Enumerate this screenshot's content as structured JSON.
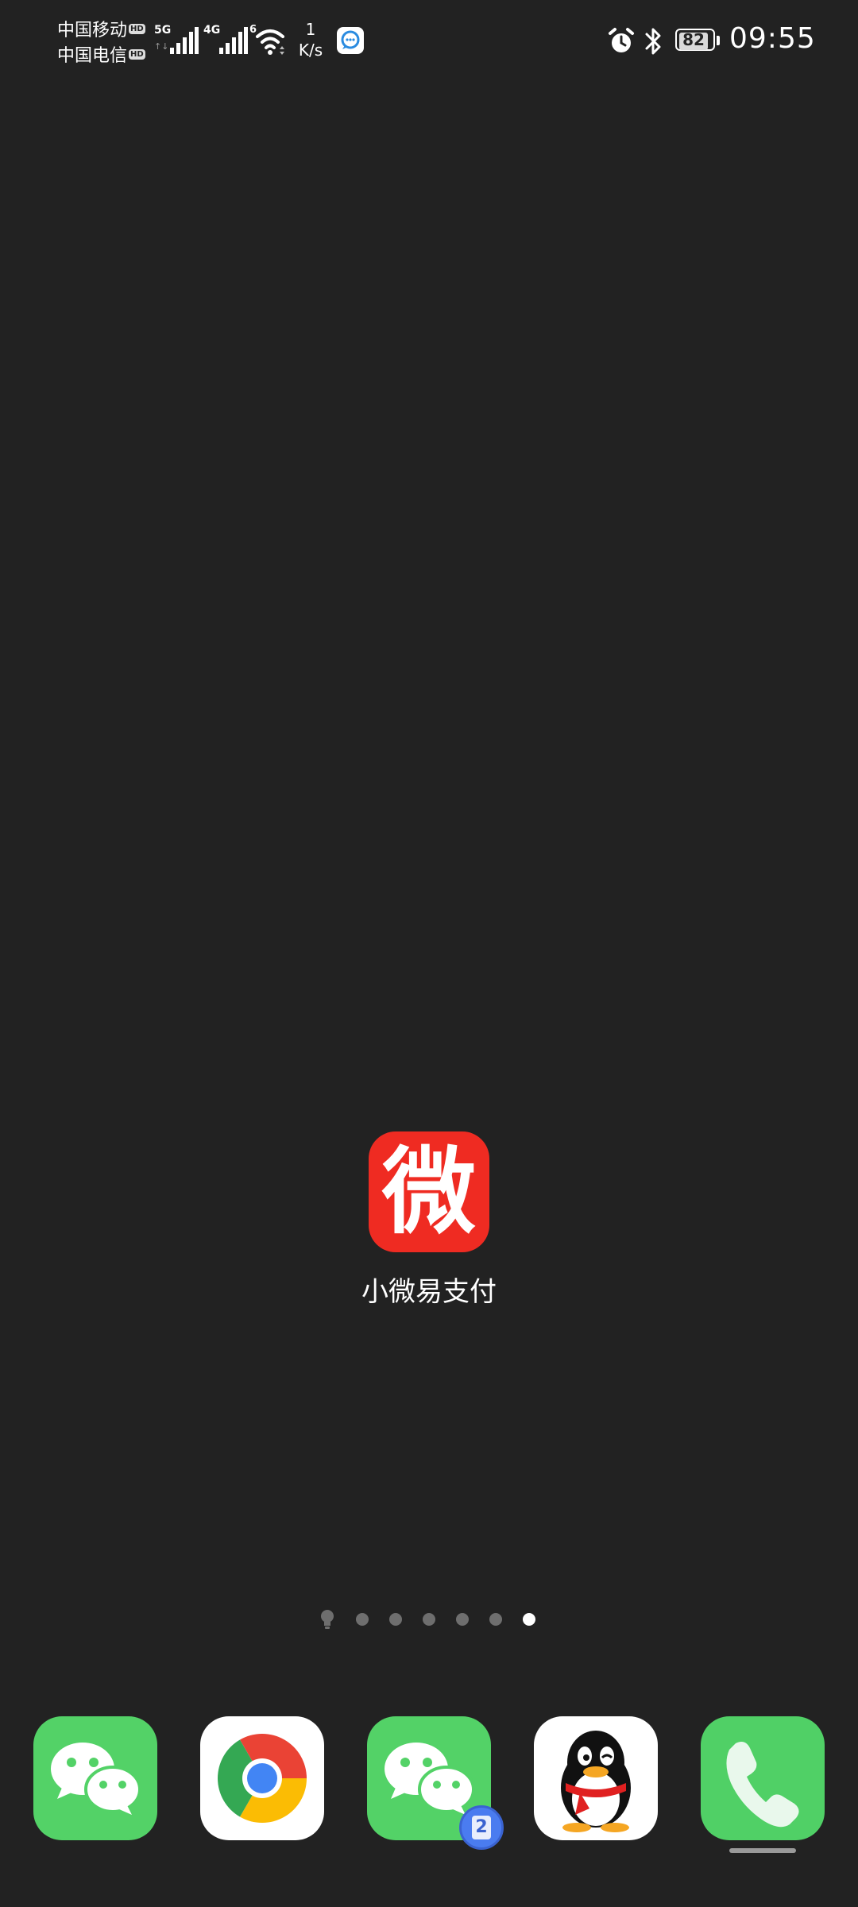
{
  "status_bar": {
    "carrier1": "中国移动",
    "carrier2": "中国电信",
    "hd": "HD",
    "sim1_network": "5G",
    "sim2_network": "4G",
    "wifi_badge": "6",
    "net_speed_value": "1",
    "net_speed_unit": "K/s",
    "battery_level": "82",
    "time": "09:55",
    "icons": [
      "alarm-icon",
      "bluetooth-icon",
      "battery-icon",
      "wifi-icon",
      "signal-icon"
    ]
  },
  "home": {
    "app": {
      "label": "小微易支付",
      "icon_glyph": "微",
      "color": "#ef2b22"
    }
  },
  "page_indicator": {
    "count": 6,
    "active_index": 5
  },
  "dock": {
    "apps": [
      {
        "name": "wechat",
        "icon": "wechat-icon"
      },
      {
        "name": "chrome",
        "icon": "chrome-icon"
      },
      {
        "name": "wechat-clone",
        "icon": "wechat-icon",
        "badge": "2"
      },
      {
        "name": "qq",
        "icon": "qq-penguin-icon"
      },
      {
        "name": "phone",
        "icon": "phone-icon"
      }
    ]
  }
}
